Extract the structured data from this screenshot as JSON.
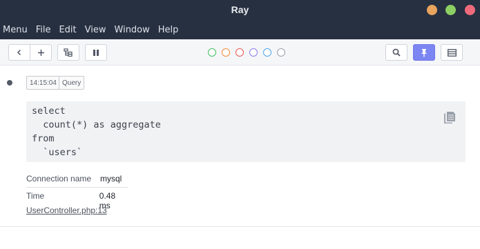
{
  "window": {
    "title": "Ray"
  },
  "menu": [
    "Menu",
    "File",
    "Edit",
    "View",
    "Window",
    "Help"
  ],
  "toolbar": {
    "color_filters": [
      "#3fbf5f",
      "#ef8a3a",
      "#e45555",
      "#8b7be8",
      "#4ea3e6",
      "#9aa0a8"
    ],
    "pin_active_color": "#7b86f3"
  },
  "entry": {
    "time": "14:15:04",
    "type": "Query",
    "code": "select\n  count(*) as aggregate\nfrom\n  `users`",
    "meta": {
      "connection_label": "Connection name",
      "connection_value": "mysql",
      "time_label": "Time",
      "time_value": "0.48 ms"
    },
    "origin": "UserController.php:13"
  }
}
